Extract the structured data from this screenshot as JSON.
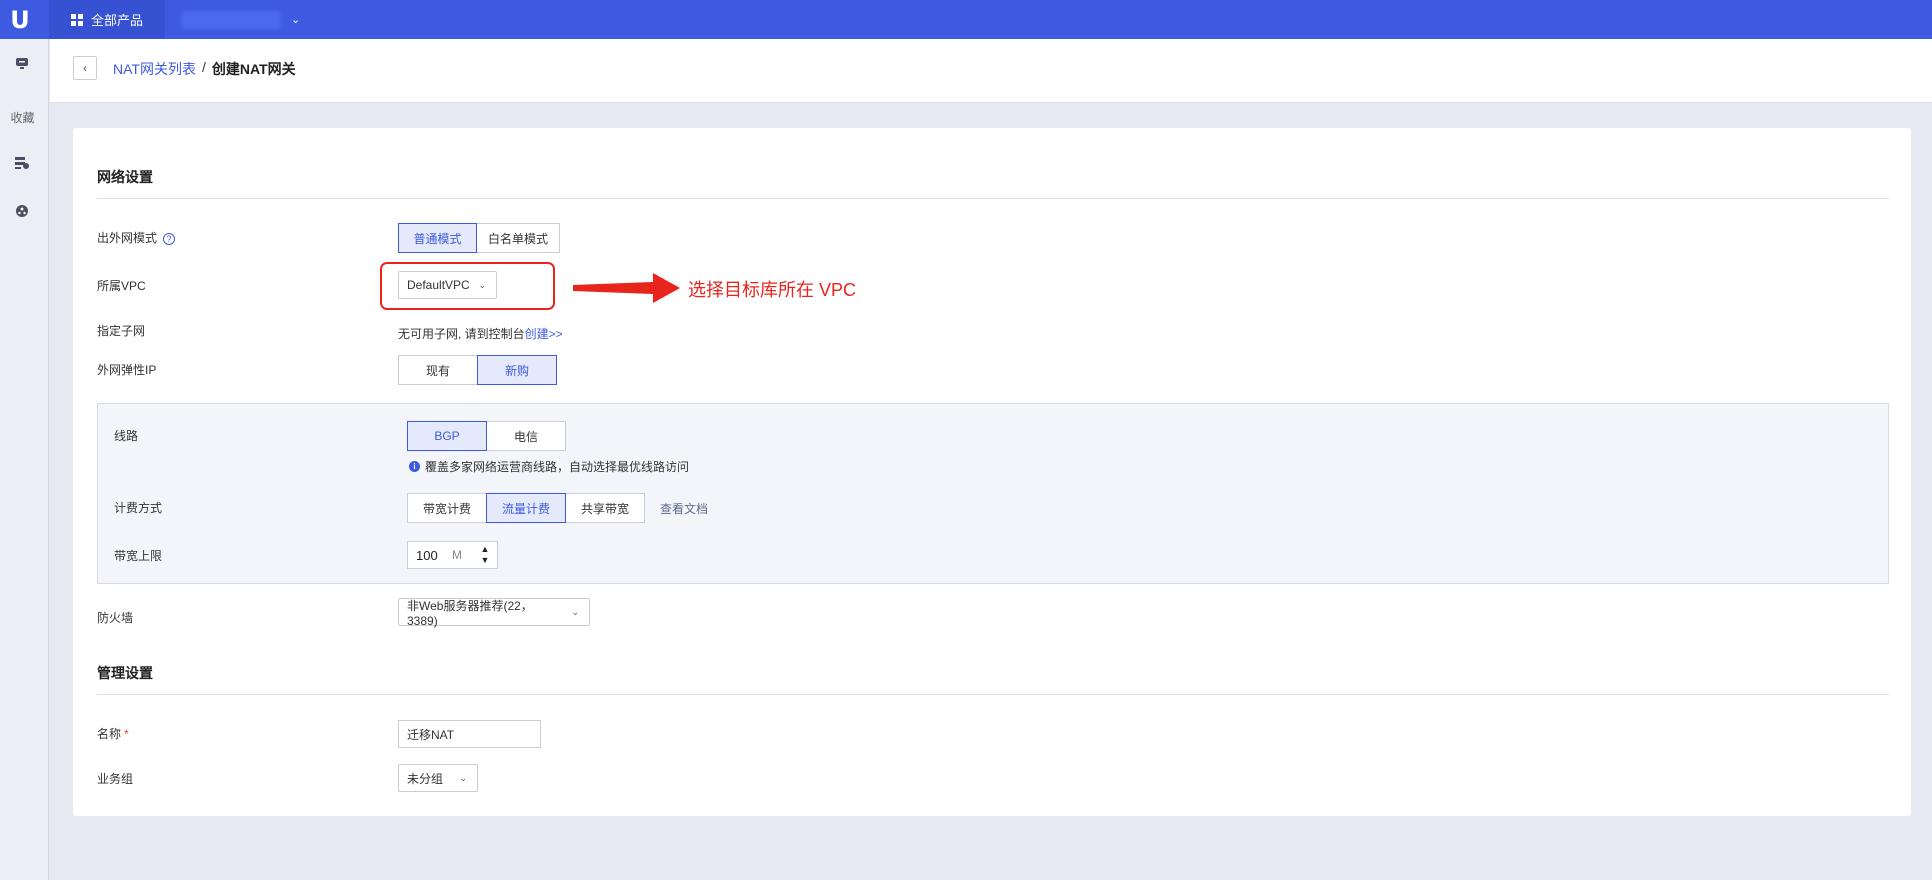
{
  "topbar": {
    "logo": "U",
    "products_label": "全部产品"
  },
  "sidebar": {
    "favorites_label": "收藏"
  },
  "breadcrumb": {
    "back": "‹",
    "parent": "NAT网关列表",
    "separator": "/",
    "current": "创建NAT网关"
  },
  "network": {
    "title": "网络设置",
    "egress_mode": {
      "label": "出外网模式",
      "help": "?",
      "options": [
        "普通模式",
        "白名单模式"
      ],
      "selected": "普通模式"
    },
    "vpc": {
      "label": "所属VPC",
      "value": "DefaultVPC"
    },
    "subnet": {
      "label": "指定子网",
      "message": "无可用子网, 请到控制台",
      "link": "创建>>"
    },
    "eip": {
      "label": "外网弹性IP",
      "options": [
        "现有",
        "新购"
      ],
      "selected": "新购"
    },
    "line": {
      "label": "线路",
      "options": [
        "BGP",
        "电信"
      ],
      "selected": "BGP",
      "tip_icon": "i",
      "tip": "覆盖多家网络运营商线路，自动选择最优线路访问"
    },
    "billing": {
      "label": "计费方式",
      "options": [
        "带宽计费",
        "流量计费",
        "共享带宽"
      ],
      "selected": "流量计费",
      "doc_link": "查看文档"
    },
    "bandwidth": {
      "label": "带宽上限",
      "value": "100",
      "unit": "M",
      "up": "▲",
      "down": "▼"
    },
    "firewall": {
      "label": "防火墙",
      "value": "非Web服务器推荐(22，3389)"
    }
  },
  "management": {
    "title": "管理设置",
    "name": {
      "label": "名称",
      "required_mark": "*",
      "value": "迁移NAT"
    },
    "group": {
      "label": "业务组",
      "value": "未分组"
    }
  },
  "annotation": {
    "text": "选择目标库所在 VPC",
    "color": "#e8251d"
  },
  "colors": {
    "primary": "#3d5ae0",
    "active_bg": "#e4e9fb",
    "page_bg": "#e6e8f2"
  }
}
